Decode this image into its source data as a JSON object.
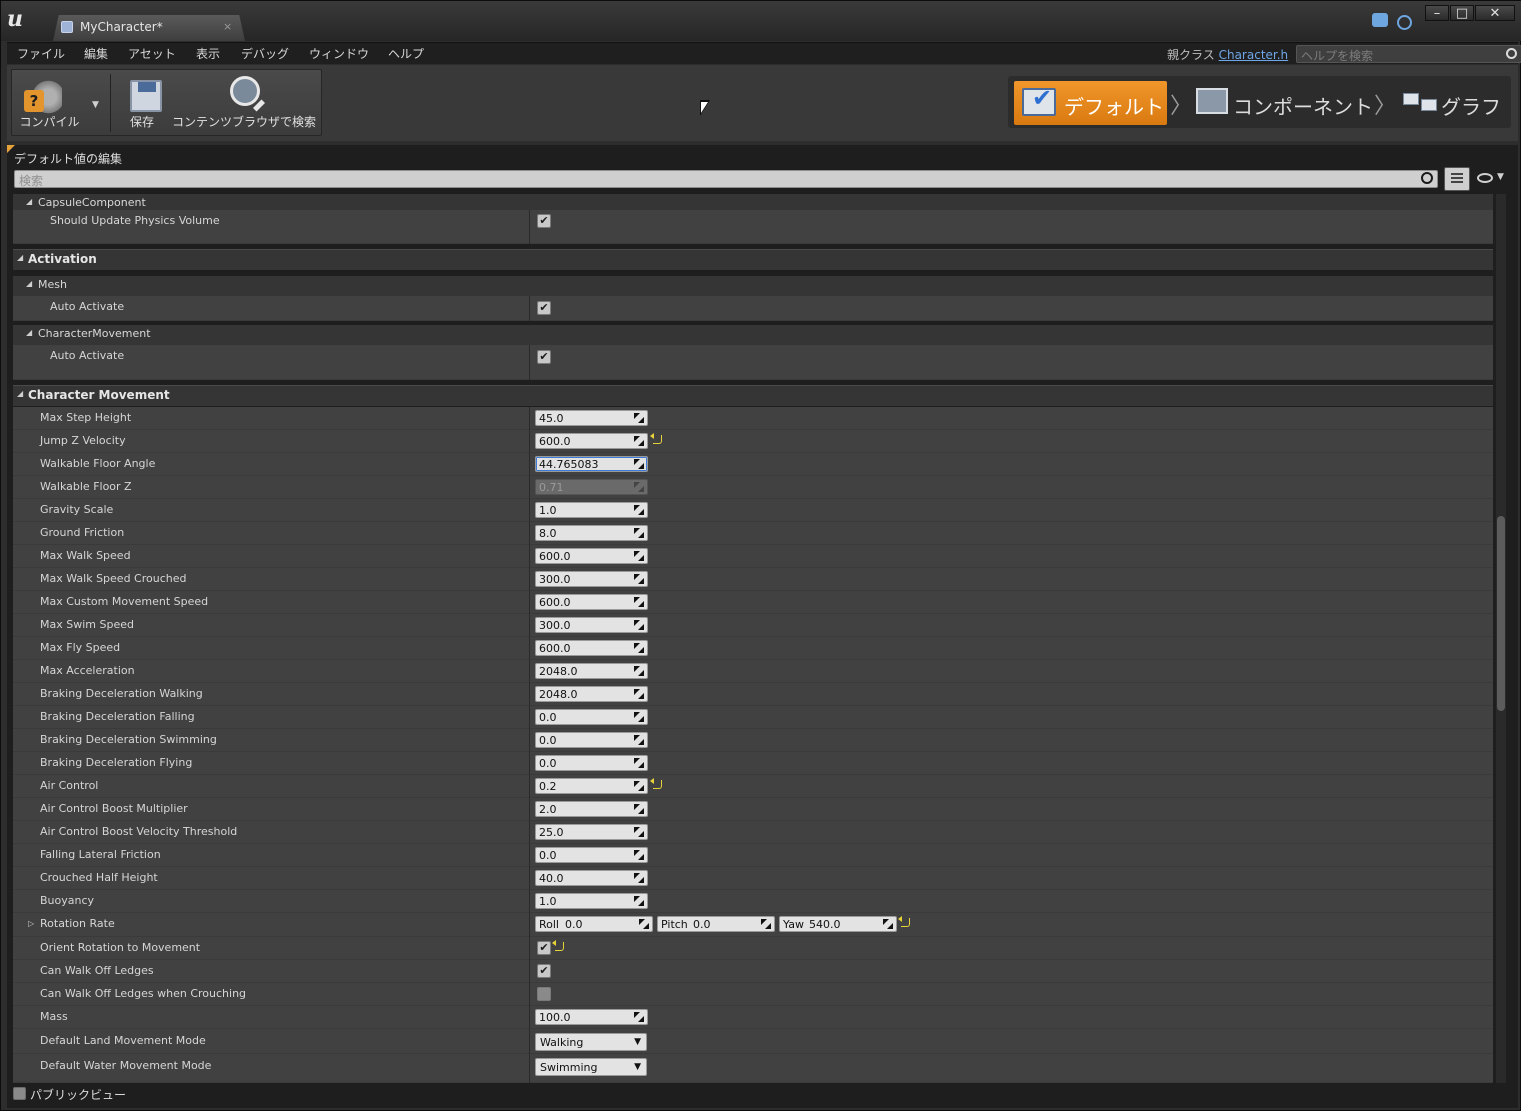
{
  "window": {
    "tab_title": "MyCharacter*",
    "tab_close": "×",
    "minimize": "–",
    "maximize": "□",
    "close": "✕"
  },
  "menu": {
    "items": [
      "ファイル",
      "編集",
      "アセット",
      "表示",
      "デバッグ",
      "ウィンドウ",
      "ヘルプ"
    ],
    "parent_class_label": "親クラス",
    "parent_class_link": "Character.h",
    "help_search_placeholder": "ヘルプを検索"
  },
  "toolbar": {
    "compile_label": "コンパイル",
    "compile_dropdown": "▼",
    "save_label": "保存",
    "browse_label": "コンテンツブラウザで検索"
  },
  "modes": {
    "defaults": "デフォルト",
    "components": "コンポーネント",
    "graph": "グラフ",
    "chevron": "〉",
    "active": "defaults",
    "active_color": "#E8891C"
  },
  "panel": {
    "title": "デフォルト値の編集",
    "search_placeholder": "検索",
    "public_view_label": "パブリックビュー",
    "public_view_checked": false
  },
  "details": {
    "capsule": {
      "category": "CapsuleComponent",
      "rows": [
        {
          "name": "Should Update Physics Volume",
          "checked": true
        }
      ]
    },
    "activation": {
      "section": "Activation",
      "mesh_category": "Mesh",
      "mesh_rows": [
        {
          "name": "Auto Activate",
          "checked": true
        }
      ],
      "movement_category": "CharacterMovement",
      "movement_rows": [
        {
          "name": "Auto Activate",
          "checked": true
        }
      ]
    },
    "character_movement": {
      "section": "Character Movement",
      "rows": [
        {
          "name": "Max Step Height",
          "value": "45.0"
        },
        {
          "name": "Jump Z Velocity",
          "value": "600.0",
          "modified": true
        },
        {
          "name": "Walkable Floor Angle",
          "value": "44.765083",
          "editing": true
        },
        {
          "name": "Walkable Floor Z",
          "value": "0.71",
          "disabled": true
        },
        {
          "name": "Gravity Scale",
          "value": "1.0"
        },
        {
          "name": "Ground Friction",
          "value": "8.0"
        },
        {
          "name": "Max Walk Speed",
          "value": "600.0"
        },
        {
          "name": "Max Walk Speed Crouched",
          "value": "300.0"
        },
        {
          "name": "Max Custom Movement Speed",
          "value": "600.0"
        },
        {
          "name": "Max Swim Speed",
          "value": "300.0"
        },
        {
          "name": "Max Fly Speed",
          "value": "600.0"
        },
        {
          "name": "Max Acceleration",
          "value": "2048.0"
        },
        {
          "name": "Braking Deceleration Walking",
          "value": "2048.0"
        },
        {
          "name": "Braking Deceleration Falling",
          "value": "0.0"
        },
        {
          "name": "Braking Deceleration Swimming",
          "value": "0.0"
        },
        {
          "name": "Braking Deceleration Flying",
          "value": "0.0"
        },
        {
          "name": "Air Control",
          "value": "0.2",
          "modified": true
        },
        {
          "name": "Air Control Boost Multiplier",
          "value": "2.0"
        },
        {
          "name": "Air Control Boost Velocity Threshold",
          "value": "25.0"
        },
        {
          "name": "Falling Lateral Friction",
          "value": "0.0"
        },
        {
          "name": "Crouched Half Height",
          "value": "40.0"
        },
        {
          "name": "Buoyancy",
          "value": "1.0"
        }
      ],
      "rotation_rate": {
        "name": "Rotation Rate",
        "roll_label": "Roll",
        "roll": "0.0",
        "pitch_label": "Pitch",
        "pitch": "0.0",
        "yaw_label": "Yaw",
        "yaw": "540.0",
        "modified": true
      },
      "orient_rotation": {
        "name": "Orient Rotation to Movement",
        "checked": true,
        "modified": true
      },
      "can_walk_off_ledges": {
        "name": "Can Walk Off Ledges",
        "checked": true
      },
      "can_walk_off_ledges_crouching": {
        "name": "Can Walk Off Ledges when Crouching",
        "checked": false
      },
      "mass": {
        "name": "Mass",
        "value": "100.0"
      },
      "default_land_mode": {
        "name": "Default Land Movement Mode",
        "value": "Walking"
      },
      "default_water_mode": {
        "name": "Default Water Movement Mode",
        "value": "Swimming"
      }
    }
  }
}
